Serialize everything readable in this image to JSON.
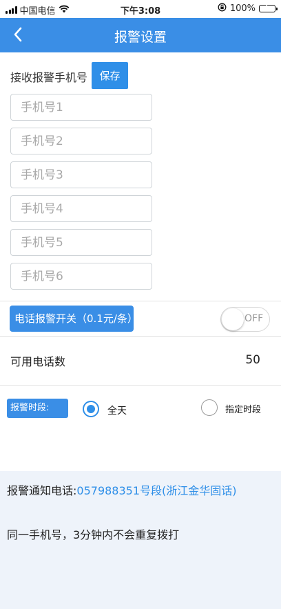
{
  "status_bar": {
    "carrier": "中国电信",
    "time": "下午3:08",
    "battery": "100%",
    "icons": [
      "signal-icon",
      "wifi-icon",
      "orientation-lock-icon",
      "battery-icon"
    ]
  },
  "nav": {
    "title": "报警设置",
    "back_icon": "chevron-left-icon"
  },
  "phones": {
    "label": "接收报警手机号",
    "save_label": "保存",
    "placeholders": [
      "手机号1",
      "手机号2",
      "手机号3",
      "手机号4",
      "手机号5",
      "手机号6"
    ]
  },
  "call_alarm": {
    "label": "电话报警开关（0.1元/条）",
    "toggle_text": "OFF",
    "enabled": false
  },
  "available": {
    "label": "可用电话数",
    "value": "50"
  },
  "period": {
    "label": "报警时段:",
    "options": [
      {
        "label": "全天",
        "selected": true
      },
      {
        "label": "指定时段",
        "selected": false
      }
    ]
  },
  "info": {
    "alarm_phone_label": "报警通知电话:",
    "alarm_phone_value": "057988351号段(浙江金华固话)",
    "note": "同一手机号，3分钟内不会重复拨打"
  },
  "colors": {
    "primary": "#3a8ee6",
    "link": "#2f8fe8",
    "info_bg": "#eef3fa"
  }
}
